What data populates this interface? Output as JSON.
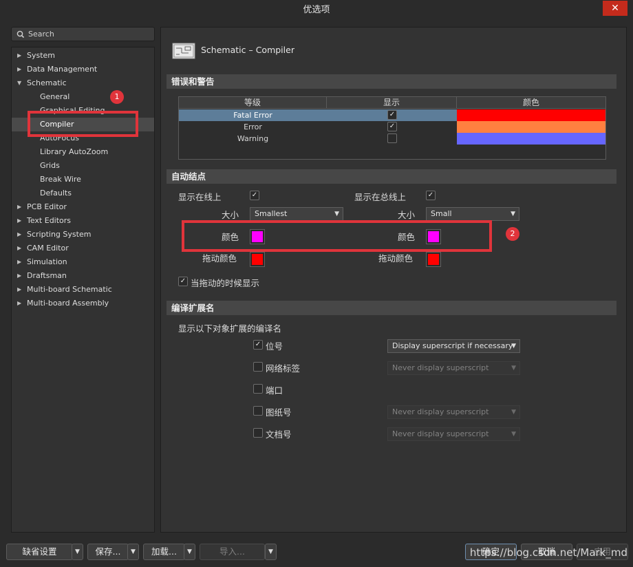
{
  "window": {
    "title": "优选项",
    "close": "✕"
  },
  "search": {
    "placeholder": "Search"
  },
  "tree": [
    {
      "label": "System",
      "arrow": "▶",
      "child": false
    },
    {
      "label": "Data Management",
      "arrow": "▶",
      "child": false
    },
    {
      "label": "Schematic",
      "arrow": "▼",
      "child": false
    },
    {
      "label": "General",
      "arrow": "",
      "child": true
    },
    {
      "label": "Graphical Editing",
      "arrow": "",
      "child": true
    },
    {
      "label": "Compiler",
      "arrow": "",
      "child": true,
      "selected": true
    },
    {
      "label": "AutoFocus",
      "arrow": "",
      "child": true
    },
    {
      "label": "Library AutoZoom",
      "arrow": "",
      "child": true
    },
    {
      "label": "Grids",
      "arrow": "",
      "child": true
    },
    {
      "label": "Break Wire",
      "arrow": "",
      "child": true
    },
    {
      "label": "Defaults",
      "arrow": "",
      "child": true
    },
    {
      "label": "PCB Editor",
      "arrow": "▶",
      "child": false
    },
    {
      "label": "Text Editors",
      "arrow": "▶",
      "child": false
    },
    {
      "label": "Scripting System",
      "arrow": "▶",
      "child": false
    },
    {
      "label": "CAM Editor",
      "arrow": "▶",
      "child": false
    },
    {
      "label": "Simulation",
      "arrow": "▶",
      "child": false
    },
    {
      "label": "Draftsman",
      "arrow": "▶",
      "child": false
    },
    {
      "label": "Multi-board Schematic",
      "arrow": "▶",
      "child": false
    },
    {
      "label": "Multi-board Assembly",
      "arrow": "▶",
      "child": false
    }
  ],
  "page": {
    "title": "Schematic – Compiler"
  },
  "errors": {
    "heading": "错误和警告",
    "columns": [
      "等级",
      "显示",
      "颜色"
    ],
    "rows": [
      {
        "level": "Fatal Error",
        "show": true,
        "color": "#ff0000"
      },
      {
        "level": "Error",
        "show": true,
        "color": "#ff8040"
      },
      {
        "level": "Warning",
        "show": false,
        "color": "#6666ff"
      }
    ]
  },
  "junction": {
    "heading": "自动结点",
    "wire": {
      "label": "显示在线上",
      "checked": true,
      "size_label": "大小",
      "size_value": "Smallest",
      "color_label": "颜色",
      "color": "#ff00ff",
      "drag_label": "拖动颜色",
      "drag_color": "#ff0000"
    },
    "bus": {
      "label": "显示在总线上",
      "checked": true,
      "size_label": "大小",
      "size_value": "Small",
      "color_label": "颜色",
      "color": "#ff00ff",
      "drag_label": "拖动颜色",
      "drag_color": "#ff0000"
    },
    "drag_show": {
      "label": "当拖动的时候显示",
      "checked": true
    }
  },
  "ext": {
    "heading": "编译扩展名",
    "subtitle": "显示以下对象扩展的编译名",
    "items": [
      {
        "label": "位号",
        "checked": true,
        "option": "Display superscript if necessary",
        "enabled": true
      },
      {
        "label": "网络标签",
        "checked": false,
        "option": "Never display superscript",
        "enabled": false
      },
      {
        "label": "端口",
        "checked": false,
        "option": "",
        "enabled": false
      },
      {
        "label": "图纸号",
        "checked": false,
        "option": "Never display superscript",
        "enabled": false
      },
      {
        "label": "文档号",
        "checked": false,
        "option": "Never display superscript",
        "enabled": false
      }
    ]
  },
  "annotations": {
    "badge1": "1",
    "badge2": "2"
  },
  "footer": {
    "defaults": "缺省设置",
    "save": "保存...",
    "load": "加载...",
    "import": "导入...",
    "ok": "确定",
    "cancel": "取消",
    "apply": "应用"
  },
  "watermark": "https://blog.csdn.net/Mark_md",
  "icons": {
    "search": "search-icon",
    "page": "schematic-sheet-icon",
    "check": "✓",
    "caret": "▼"
  }
}
